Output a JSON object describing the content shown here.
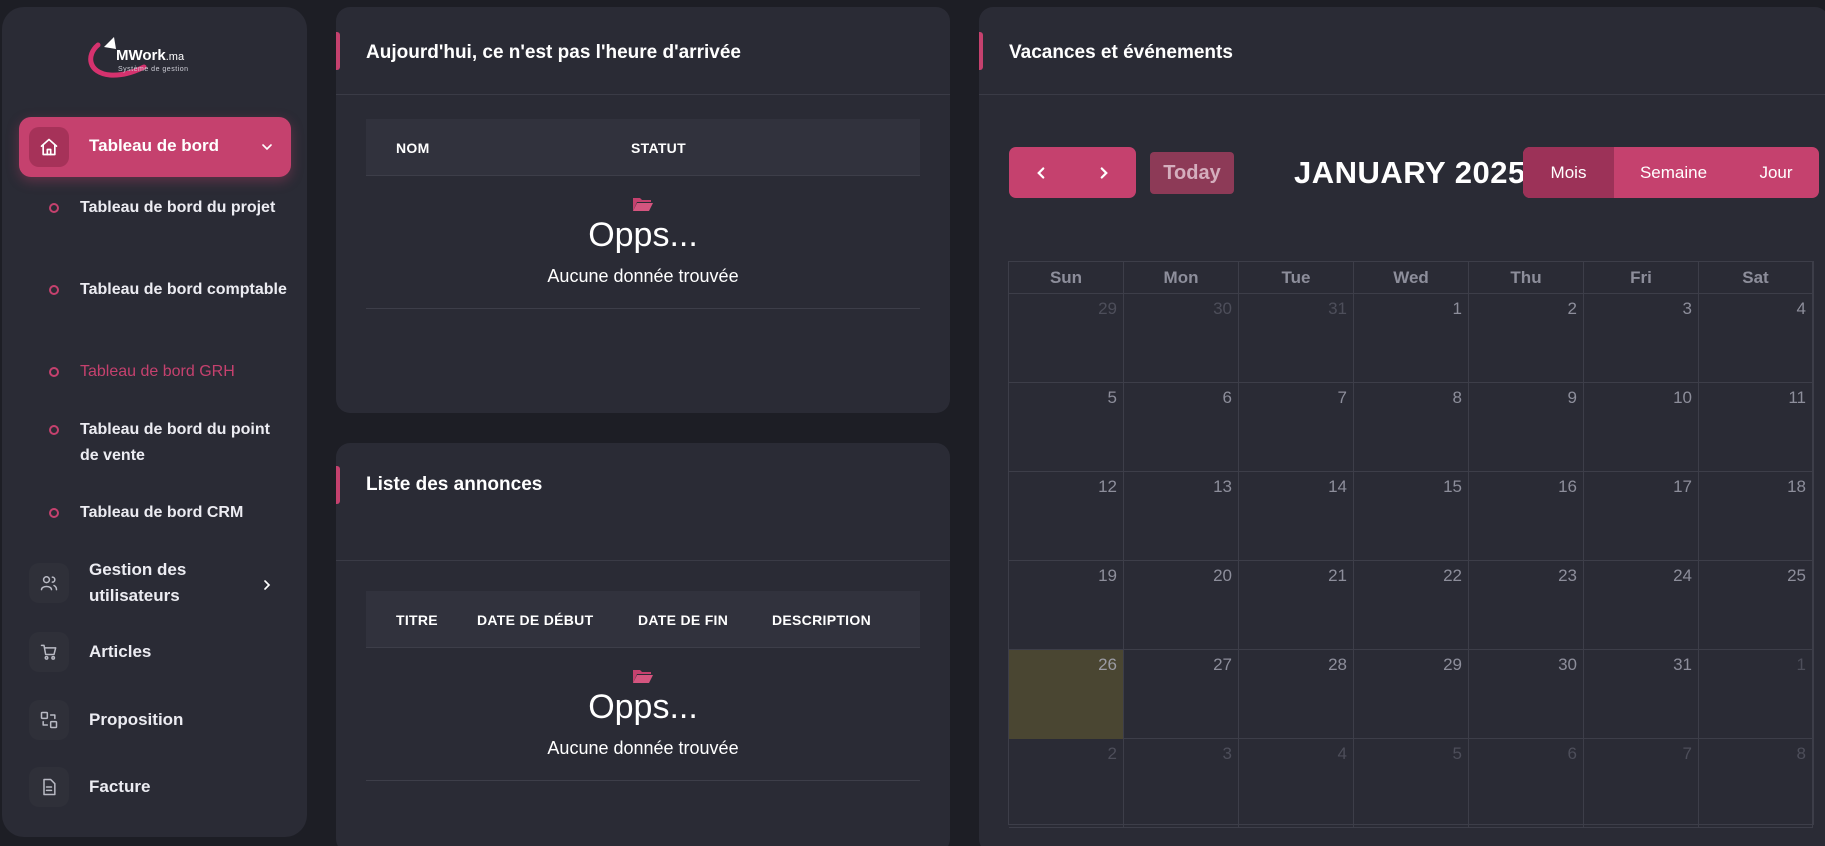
{
  "logo": {
    "brand": "MWork",
    "suffix": ".ma",
    "tagline": "Système de gestion"
  },
  "sidebar": {
    "active": {
      "label": "Tableau de bord",
      "icon": "home-icon"
    },
    "sub_items": [
      {
        "label": "Tableau de bord du projet",
        "active": false
      },
      {
        "label": "Tableau de bord comptable",
        "active": false
      },
      {
        "label": "Tableau de bord GRH",
        "active": true
      },
      {
        "label": "Tableau de bord du point de vente",
        "active": false
      },
      {
        "label": "Tableau de bord CRM",
        "active": false
      }
    ],
    "items": [
      {
        "label": "Gestion des utilisateurs",
        "icon": "users-icon",
        "has_children": true
      },
      {
        "label": "Articles",
        "icon": "cart-icon",
        "has_children": false
      },
      {
        "label": "Proposition",
        "icon": "exchange-icon",
        "has_children": false
      },
      {
        "label": "Facture",
        "icon": "invoice-icon",
        "has_children": false
      }
    ]
  },
  "arrival_card": {
    "title": "Aujourd'hui, ce n'est pas l'heure d'arrivée",
    "columns": [
      "NOM",
      "STATUT"
    ],
    "empty_title": "Opps...",
    "empty_text": "Aucune donnée trouvée"
  },
  "announce_card": {
    "title": "Liste des annonces",
    "columns": [
      "TITRE",
      "DATE DE DÉBUT",
      "DATE DE FIN",
      "DESCRIPTION"
    ],
    "empty_title": "Opps...",
    "empty_text": "Aucune donnée trouvée"
  },
  "calendar_card": {
    "title": "Vacances et événements",
    "today_label": "Today",
    "month_title": "JANUARY 2025",
    "views": [
      "Mois",
      "Semaine",
      "Jour"
    ],
    "selected_view": "Mois",
    "weekdays": [
      "Sun",
      "Mon",
      "Tue",
      "Wed",
      "Thu",
      "Fri",
      "Sat"
    ],
    "weeks": [
      [
        "29",
        "30",
        "31",
        "1",
        "2",
        "3",
        "4"
      ],
      [
        "5",
        "6",
        "7",
        "8",
        "9",
        "10",
        "11"
      ],
      [
        "12",
        "13",
        "14",
        "15",
        "16",
        "17",
        "18"
      ],
      [
        "19",
        "20",
        "21",
        "22",
        "23",
        "24",
        "25"
      ],
      [
        "26",
        "27",
        "28",
        "29",
        "30",
        "31",
        "1"
      ],
      [
        "2",
        "3",
        "4",
        "5",
        "6",
        "7",
        "8"
      ]
    ],
    "today_date": "26"
  },
  "colors": {
    "accent": "#c5416e",
    "accent_dark": "#9c3258",
    "background": "#1d1e25",
    "card": "#2a2b35",
    "today_cell": "#4a4632"
  }
}
